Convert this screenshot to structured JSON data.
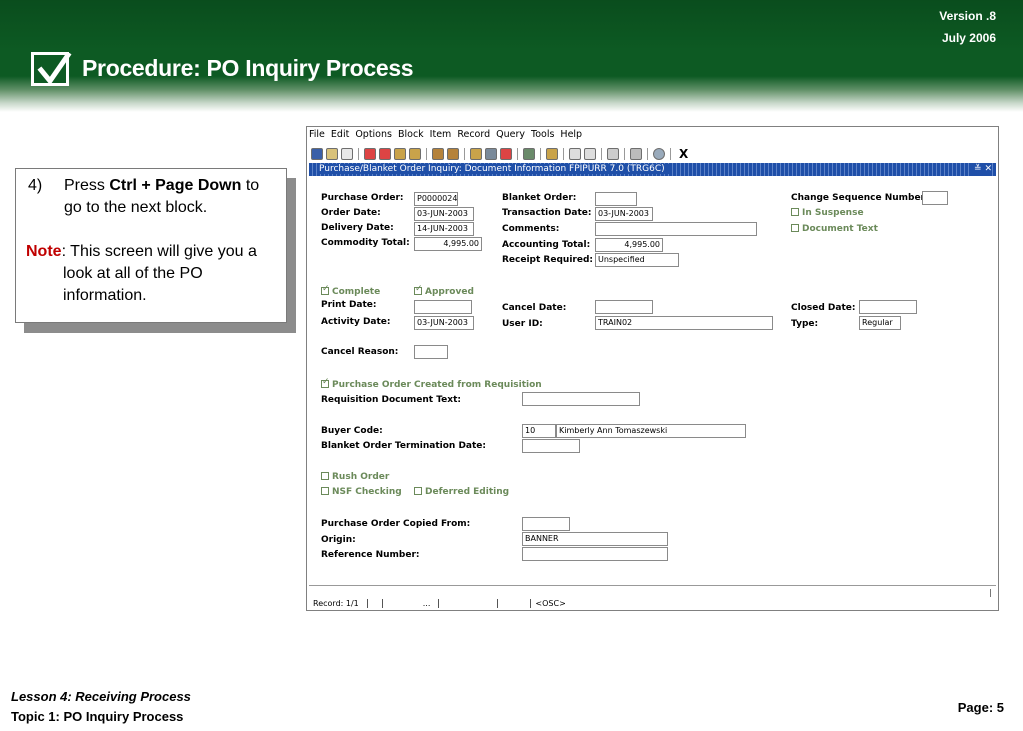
{
  "header": {
    "version": "Version .8",
    "date": "July  2006",
    "title": "Procedure: PO Inquiry Process"
  },
  "callout": {
    "step_number": "4)",
    "step_prefix": "Press ",
    "step_key": "Ctrl + Page Down",
    "step_suffix": " to go to the next block.",
    "note_label": "Note",
    "note_text_1": ":  This screen will give you a",
    "note_text_2": "look at all of the PO information."
  },
  "app": {
    "menu": [
      "File",
      "Edit",
      "Options",
      "Block",
      "Item",
      "Record",
      "Query",
      "Tools",
      "Help"
    ],
    "close_glyph": "X",
    "form_title": "Purchase/Blanket Order Inquiry: Document Information  FPIPURR  7.0  (TRG6C)",
    "form_controls": "≚ ✕"
  },
  "form": {
    "purchase_order_label": "Purchase Order:",
    "purchase_order_value": "P0000024",
    "blanket_order_label": "Blanket Order:",
    "blanket_order_value": "",
    "change_seq_label": "Change Sequence Number:",
    "change_seq_value": "",
    "order_date_label": "Order Date:",
    "order_date_value": "03-JUN-2003",
    "transaction_date_label": "Transaction Date:",
    "transaction_date_value": "03-JUN-2003",
    "in_suspense_label": "In Suspense",
    "delivery_date_label": "Delivery Date:",
    "delivery_date_value": "14-JUN-2003",
    "comments_label": "Comments:",
    "comments_value": "",
    "document_text_label": "Document Text",
    "commodity_total_label": "Commodity Total:",
    "commodity_total_value": "4,995.00",
    "accounting_total_label": "Accounting Total:",
    "accounting_total_value": "4,995.00",
    "receipt_required_label": "Receipt Required:",
    "receipt_required_value": "Unspecified",
    "complete_label": "Complete",
    "approved_label": "Approved",
    "print_date_label": "Print Date:",
    "print_date_value": "",
    "cancel_date_label": "Cancel Date:",
    "cancel_date_value": "",
    "closed_date_label": "Closed Date:",
    "closed_date_value": "",
    "activity_date_label": "Activity Date:",
    "activity_date_value": "03-JUN-2003",
    "user_id_label": "User ID:",
    "user_id_value": "TRAIN02",
    "type_label": "Type:",
    "type_value": "Regular",
    "cancel_reason_label": "Cancel Reason:",
    "cancel_reason_value": "",
    "po_from_req_label": "Purchase Order Created from Requisition",
    "req_doc_text_label": "Requisition Document Text:",
    "req_doc_text_value": "",
    "buyer_code_label": "Buyer Code:",
    "buyer_code_value": "10",
    "buyer_name_value": "Kimberly Ann  Tomaszewski",
    "blanket_term_label": "Blanket Order Termination Date:",
    "blanket_term_value": "",
    "rush_order_label": "Rush Order",
    "nsf_checking_label": "NSF Checking",
    "deferred_editing_label": "Deferred Editing",
    "po_copied_label": "Purchase Order Copied From:",
    "po_copied_value": "",
    "origin_label": "Origin:",
    "origin_value": "BANNER",
    "reference_label": "Reference Number:",
    "reference_value": ""
  },
  "status": {
    "record": "Record: 1/1",
    "ellipsis": "...",
    "osc": "<OSC>"
  },
  "footer": {
    "lesson": "Lesson 4: Receiving Process",
    "topic": "Topic 1: PO Inquiry Process",
    "page": "Page: 5"
  }
}
